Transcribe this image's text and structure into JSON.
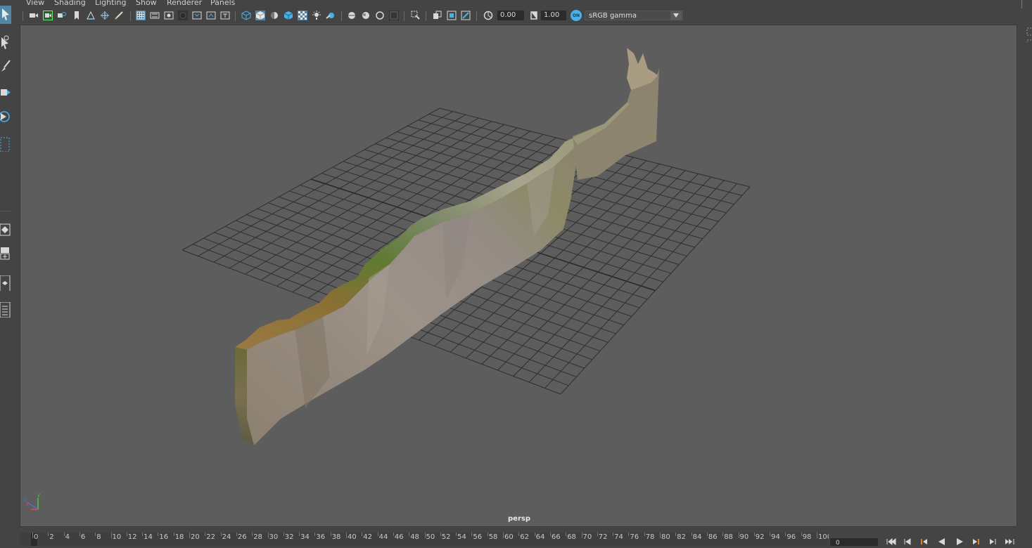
{
  "menubar": {
    "items": [
      "View",
      "Shading",
      "Lighting",
      "Show",
      "Renderer",
      "Panels"
    ]
  },
  "toolbar": {
    "icons": [
      "select-camera-icon",
      "camera-attributes-icon",
      "bookmark-icon",
      "image-plane-icon",
      "2d-pan-zoom-icon",
      "grease-pencil-icon",
      "grid-icon",
      "film-gate-icon",
      "resolution-gate-icon",
      "gate-mask-icon",
      "field-chart-icon",
      "safe-action-icon",
      "safe-title-icon",
      "wireframe-icon",
      "smooth-shade-icon",
      "default-material-icon",
      "textured-icon",
      "use-all-lights-icon",
      "shadows-icon",
      "screen-space-ao-icon",
      "motion-blur-icon",
      "multisample-aa-icon",
      "depth-of-field-icon",
      "isolate-select-icon",
      "xray-icon",
      "xray-joints-icon",
      "xray-components-icon",
      "exposure-icon",
      "gamma-icon"
    ],
    "exposure_value": "0.00",
    "gamma_value": "1.00",
    "color_management_badge": "ON",
    "view_transform": "sRGB gamma"
  },
  "viewport": {
    "camera_label": "persp",
    "background_color": "#5d5d5d",
    "grid_color": "#2f2f2f",
    "axis_labels": [
      "x",
      "y",
      "z"
    ]
  },
  "timeline": {
    "ticks": [
      "0",
      "2",
      "4",
      "6",
      "8",
      "10",
      "12",
      "14",
      "16",
      "18",
      "20",
      "22",
      "24",
      "26",
      "28",
      "30",
      "32",
      "34",
      "36",
      "38",
      "40",
      "42",
      "44",
      "46",
      "48",
      "50",
      "52",
      "54",
      "56",
      "58",
      "60",
      "62",
      "64",
      "66",
      "68",
      "70",
      "72",
      "74",
      "76",
      "78",
      "80",
      "82",
      "84",
      "86",
      "88",
      "90",
      "92",
      "94",
      "96",
      "98",
      "100"
    ],
    "current_frame_field": "0"
  },
  "playback": {
    "icons": [
      "go-to-start-icon",
      "step-back-key-icon",
      "step-back-frame-icon",
      "play-backwards-icon",
      "play-forwards-icon",
      "step-forward-frame-icon",
      "step-forward-key-icon",
      "go-to-end-icon"
    ]
  },
  "left_tools": [
    "select-tool-icon",
    "lasso-tool-icon",
    "paint-select-tool-icon",
    "move-tool-icon",
    "rotate-tool-icon",
    "scale-tool-icon"
  ],
  "colors": {
    "accent": "#5285a6",
    "panel": "#444444",
    "viewport": "#5d5d5d"
  }
}
